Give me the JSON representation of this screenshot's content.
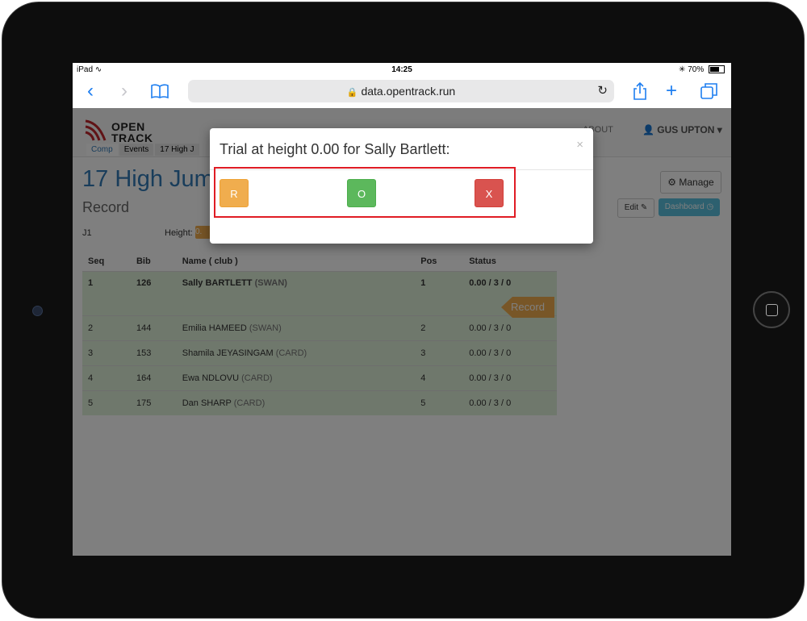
{
  "status_bar": {
    "device": "iPad",
    "time": "14:25",
    "battery": "70%"
  },
  "browser": {
    "url": "data.opentrack.run"
  },
  "site": {
    "logo_line1": "OPEN",
    "logo_line2": "TRACK",
    "subnav": [
      "Comp",
      "Events",
      "17 High J"
    ],
    "nav_about": "ABOUT",
    "nav_user": "GUS UPTON"
  },
  "page": {
    "title": "17 High Jum",
    "subtitle": "Record",
    "manage_label": "Manage",
    "edit_label": "Edit",
    "dashboard_label": "Dashboard",
    "judge": "J1",
    "height_label": "Height:",
    "height_value": "0.",
    "record_tag": "Record"
  },
  "table": {
    "headers": [
      "Seq",
      "Bib",
      "Name ( club )",
      "Pos",
      "Status"
    ],
    "rows": [
      {
        "seq": "1",
        "bib": "126",
        "name": "Sally BARTLETT",
        "club": "(SWAN)",
        "pos": "1",
        "status": "0.00 / 3 / 0"
      },
      {
        "seq": "2",
        "bib": "144",
        "name": "Emilia HAMEED",
        "club": "(SWAN)",
        "pos": "2",
        "status": "0.00 / 3 / 0"
      },
      {
        "seq": "3",
        "bib": "153",
        "name": "Shamila JEYASINGAM",
        "club": "(CARD)",
        "pos": "3",
        "status": "0.00 / 3 / 0"
      },
      {
        "seq": "4",
        "bib": "164",
        "name": "Ewa NDLOVU",
        "club": "(CARD)",
        "pos": "4",
        "status": "0.00 / 3 / 0"
      },
      {
        "seq": "5",
        "bib": "175",
        "name": "Dan SHARP",
        "club": "(CARD)",
        "pos": "5",
        "status": "0.00 / 3 / 0"
      }
    ]
  },
  "modal": {
    "title": "Trial at height 0.00 for Sally Bartlett:",
    "close": "×",
    "buttons": {
      "r": "R",
      "o": "O",
      "x": "X"
    }
  },
  "colors": {
    "accent": "#337ab7",
    "warning": "#f0ad4e",
    "success": "#5cb85c",
    "danger": "#d9534f",
    "info": "#5bc0de",
    "highlight": "#e01c24"
  },
  "icons": [
    "wifi-icon",
    "bluetooth-icon",
    "battery-icon",
    "back-icon",
    "forward-icon",
    "bookmarks-icon",
    "lock-icon",
    "reload-icon",
    "share-icon",
    "new-tab-icon",
    "tabs-icon",
    "user-icon",
    "gear-icon",
    "edit-icon",
    "dashboard-icon",
    "close-icon"
  ]
}
